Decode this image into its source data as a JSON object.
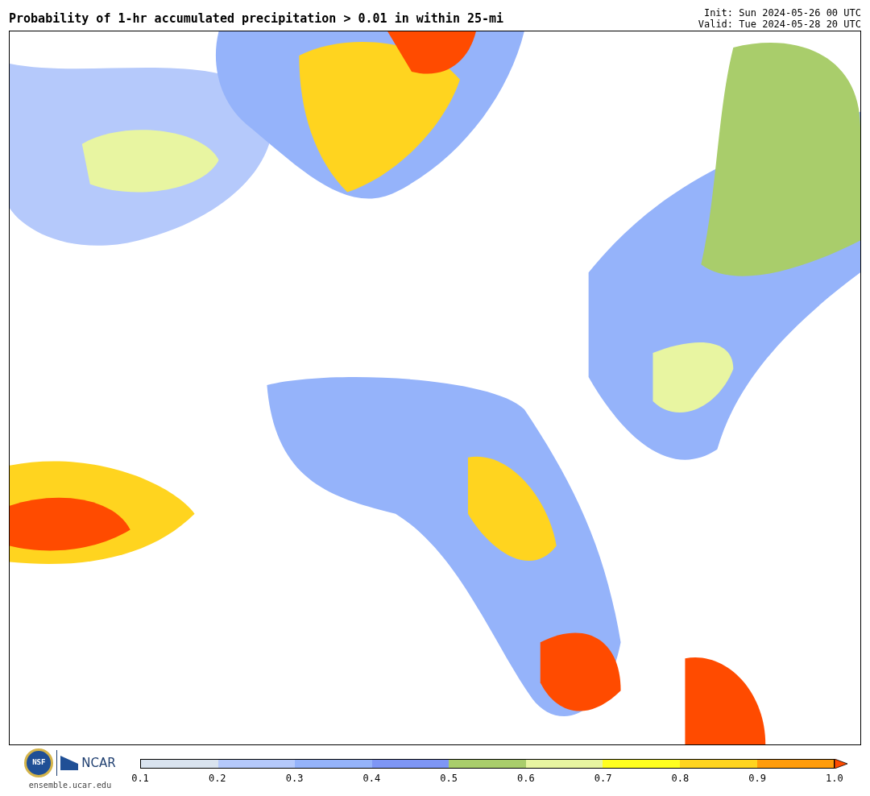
{
  "title": "Probability of 1-hr accumulated precipitation > 0.01 in within 25-mi",
  "init": "Init: Sun 2024-05-26 00 UTC",
  "valid": "Valid: Tue 2024-05-28 20 UTC",
  "logos": {
    "nsf": "NSF",
    "ncar": "NCAR",
    "site": "ensemble.ucar.edu"
  },
  "colorbar": {
    "segments": [
      {
        "kind": "band",
        "color": "#d9e3ef"
      },
      {
        "kind": "band",
        "color": "#b5c9fb"
      },
      {
        "kind": "band",
        "color": "#95b3fa"
      },
      {
        "kind": "band",
        "color": "#7e96f5"
      },
      {
        "kind": "band",
        "color": "#a9cd6b"
      },
      {
        "kind": "band",
        "color": "#e8f5a1"
      },
      {
        "kind": "band",
        "color": "#ffff1f"
      },
      {
        "kind": "band",
        "color": "#ffd41f"
      },
      {
        "kind": "band",
        "color": "#ff9c0b"
      },
      {
        "kind": "arrow",
        "color": "#ff4b00"
      }
    ],
    "ticks": [
      "0.1",
      "0.2",
      "0.3",
      "0.4",
      "0.5",
      "0.6",
      "0.7",
      "0.8",
      "0.9",
      "1.0"
    ]
  }
}
